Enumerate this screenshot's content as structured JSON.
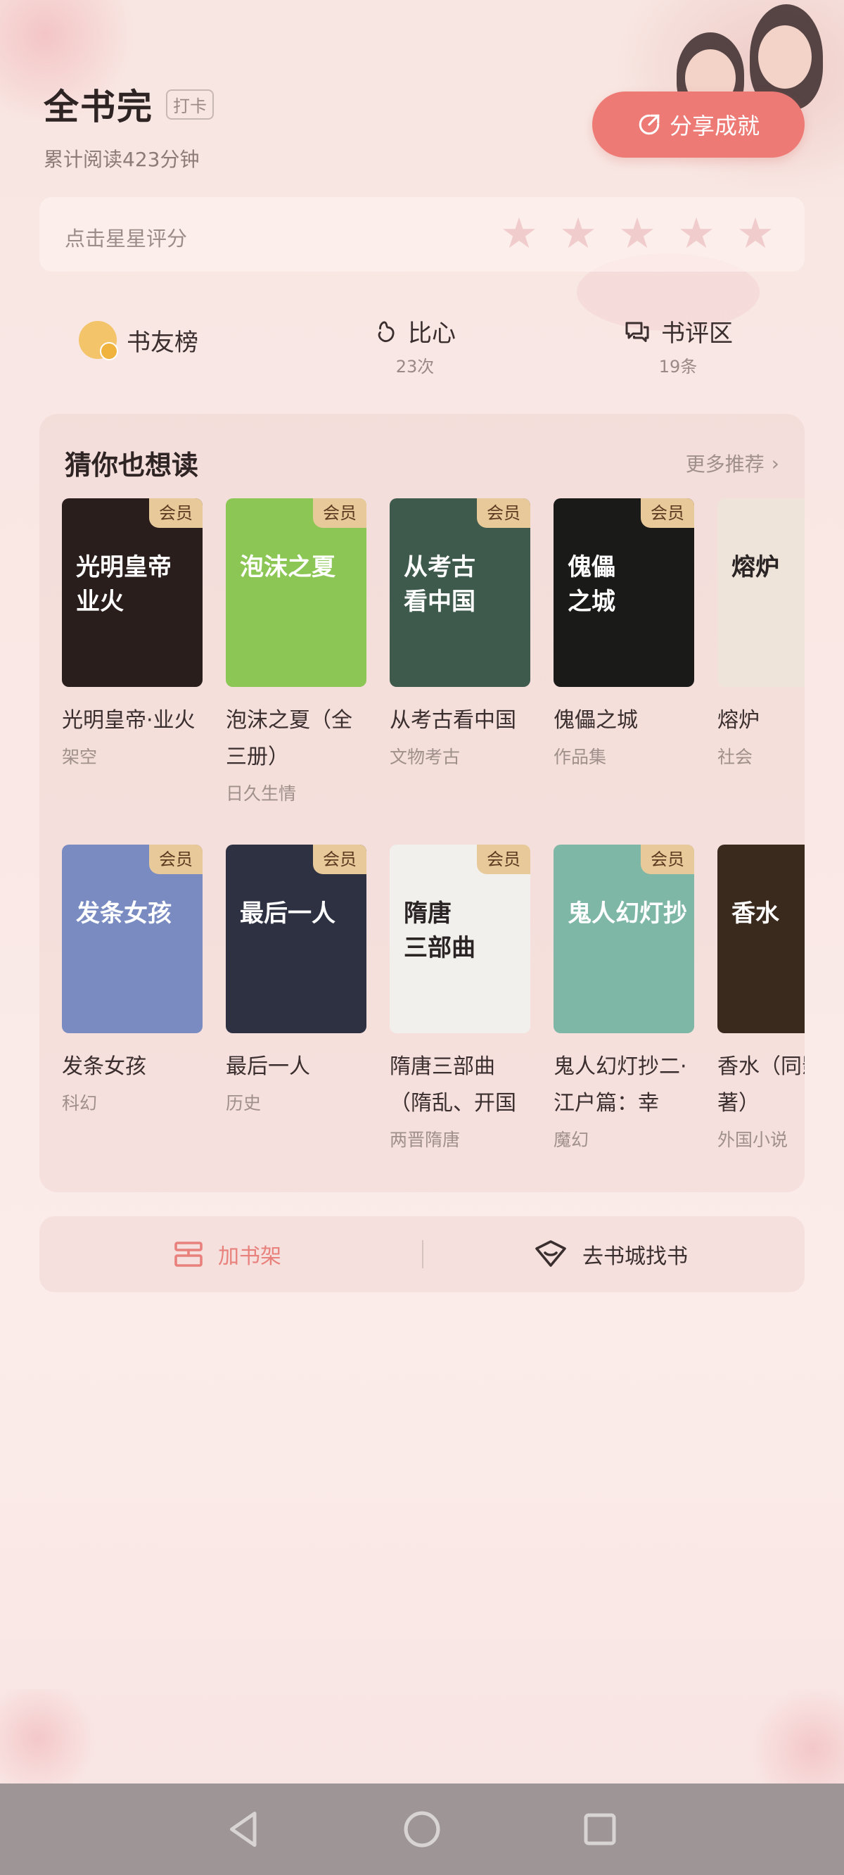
{
  "header": {
    "title": "全书完",
    "checkin_label": "打卡",
    "read_time": "累计阅读423分钟",
    "share_label": "分享成就"
  },
  "rating": {
    "hint": "点击星星评分",
    "star_count": 5
  },
  "stats": {
    "friends_label": "书友榜",
    "likes_label": "比心",
    "likes_count": "23次",
    "reviews_label": "书评区",
    "reviews_count": "19条"
  },
  "recommend": {
    "title": "猜你也想读",
    "more_label": "更多推荐",
    "member_tag": "会员",
    "books": [
      {
        "name": "光明皇帝·业火",
        "category": "架空",
        "cover_text": "光明皇帝\n业火",
        "cover_color": "#2a1e1c",
        "member": true
      },
      {
        "name": "泡沫之夏（全三册）",
        "category": "日久生情",
        "cover_text": "泡沫之夏",
        "cover_color": "#8cc654",
        "member": true
      },
      {
        "name": "从考古看中国",
        "category": "文物考古",
        "cover_text": "从考古\n看中国",
        "cover_color": "#3e5a4c",
        "member": true
      },
      {
        "name": "傀儡之城",
        "category": "作品集",
        "cover_text": "傀儡\n之城",
        "cover_color": "#1a1a18",
        "member": true
      },
      {
        "name": "熔炉",
        "category": "社会",
        "cover_text": "熔炉",
        "cover_color": "#efe4da",
        "member": false
      },
      {
        "name": "发条女孩",
        "category": "科幻",
        "cover_text": "发条女孩",
        "cover_color": "#7a8bc2",
        "member": true
      },
      {
        "name": "最后一人",
        "category": "历史",
        "cover_text": "最后一人",
        "cover_color": "#2d3142",
        "member": true
      },
      {
        "name": "隋唐三部曲（隋乱、开国",
        "category": "两晋隋唐",
        "cover_text": "隋唐\n三部曲",
        "cover_color": "#f2f0ec",
        "member": true
      },
      {
        "name": "鬼人幻灯抄二·江户篇：幸",
        "category": "魔幻",
        "cover_text": "鬼人幻灯抄",
        "cover_color": "#7fb7a6",
        "member": true
      },
      {
        "name": "香水（同影原著）",
        "category": "外国小说",
        "cover_text": "香水",
        "cover_color": "#3a2a1e",
        "member": false
      }
    ]
  },
  "actions": {
    "add_shelf": "加书架",
    "go_store": "去书城找书"
  },
  "colors": {
    "accent": "#ee7a76",
    "member_tag": "#e8c99a"
  },
  "nav": {
    "back": "back-icon",
    "home": "home-icon",
    "recents": "recents-icon"
  }
}
